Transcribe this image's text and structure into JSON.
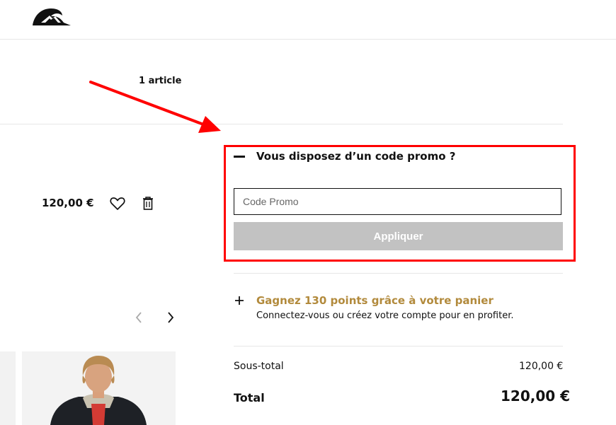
{
  "header": {
    "logo_icon": "quiksilver-logo-icon"
  },
  "cart": {
    "items_count": "1 article",
    "item": {
      "price": "120,00 €",
      "wishlist_icon": "heart-icon",
      "delete_icon": "trash-icon"
    }
  },
  "promo": {
    "toggle_icon": "minus-icon",
    "title": "Vous disposez d’un code promo ?",
    "input_value": "",
    "input_placeholder": "Code Promo",
    "apply_label": "Appliquer"
  },
  "loyalty": {
    "toggle_icon": "plus-icon",
    "title": "Gagnez 130 points grâce à votre panier",
    "subtitle": "Connectez-vous ou créez votre compte pour en profiter."
  },
  "summary": {
    "subtotal_label": "Sous-total",
    "subtotal_value": "120,00 €",
    "total_label": "Total",
    "total_value": "120,00 €"
  },
  "carousel": {
    "prev_icon": "chevron-left-icon",
    "next_icon": "chevron-right-icon"
  },
  "colors": {
    "highlight": "#ff0000",
    "loyalty_gold": "#b28a3c",
    "disabled_button": "#c2c2c2"
  }
}
